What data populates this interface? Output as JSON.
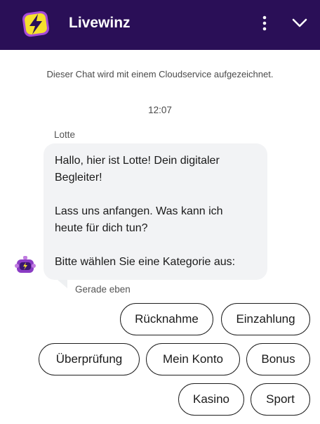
{
  "header": {
    "title": "Livewinz",
    "logo_icon": "lightning-bolt-icon",
    "menu_icon": "more-vertical-icon",
    "collapse_icon": "chevron-down-icon",
    "background_color": "#2a0f57",
    "logo_color": "#f5e12d",
    "logo_accent": "#a64bd9"
  },
  "chat": {
    "notice": "Dieser Chat wird mit einem Cloudservice aufgezeichnet.",
    "timestamp": "12:07",
    "sender_name": "Lotte",
    "message_greeting": "Hallo, hier ist Lotte! Dein digitaler\nBegleiter!",
    "message_prompt": "Lass uns anfangen. Was kann ich\nheute für dich tun?",
    "message_select": "Bitte wählen Sie eine Kategorie aus:",
    "status": "Gerade eben",
    "avatar_icon": "bot-avatar-icon"
  },
  "options": [
    {
      "label": "Rücknahme"
    },
    {
      "label": "Einzahlung"
    },
    {
      "label": "Überprüfung"
    },
    {
      "label": "Mein Konto"
    },
    {
      "label": "Bonus"
    },
    {
      "label": "Kasino"
    },
    {
      "label": "Sport"
    }
  ]
}
